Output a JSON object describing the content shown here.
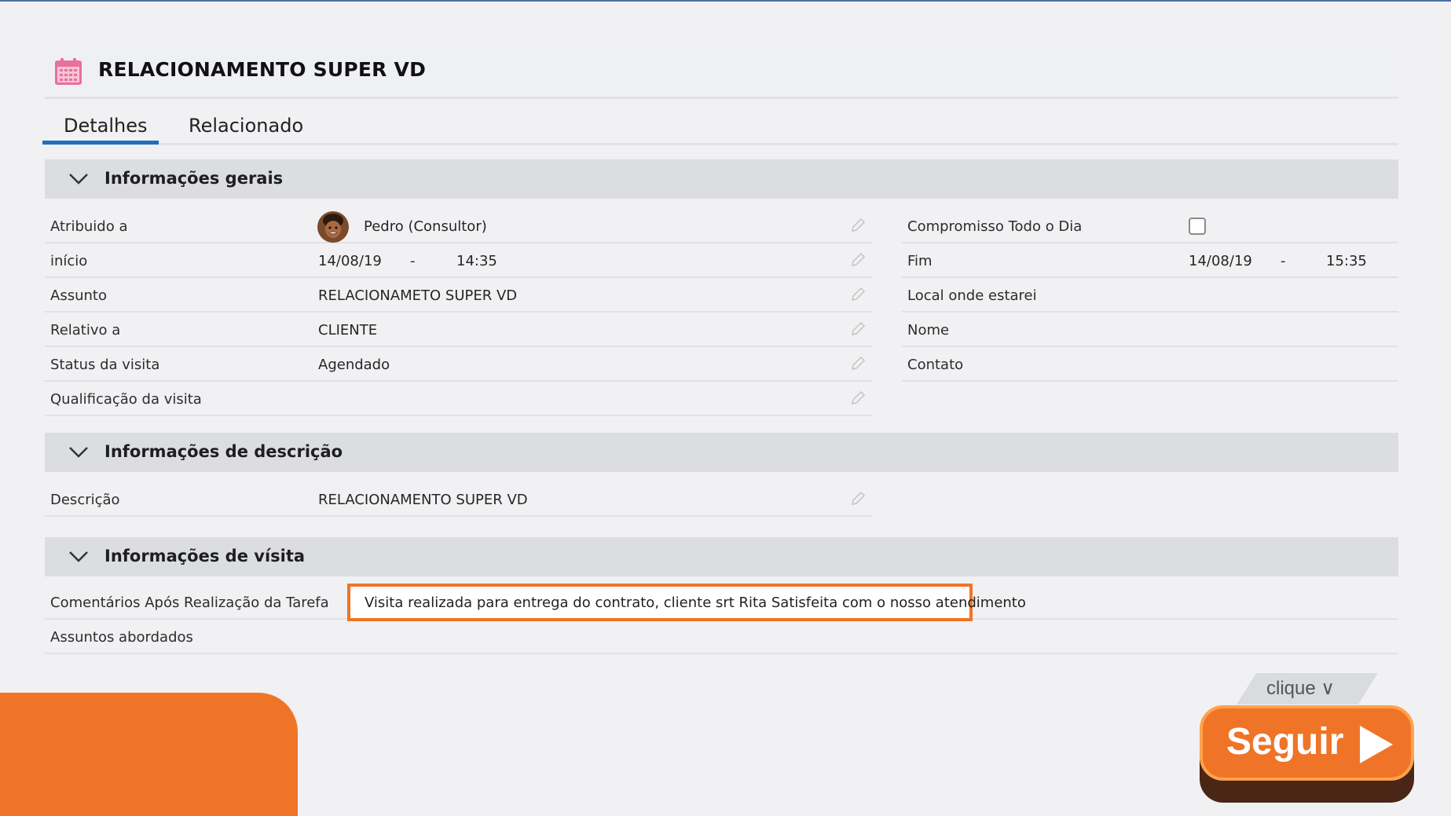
{
  "header": {
    "title": "RELACIONAMENTO SUPER VD",
    "icon": "calendar-icon",
    "icon_color": "#e8709a"
  },
  "tabs": [
    {
      "label": "Detalhes",
      "active": true
    },
    {
      "label": "Relacionado",
      "active": false
    }
  ],
  "sections": {
    "general": {
      "title": "Informações gerais",
      "left_rows": [
        {
          "label": "Atribuido a",
          "value": "Pedro (Consultor)"
        },
        {
          "label": "início",
          "date": "14/08/19",
          "sep": "-",
          "time": "14:35"
        },
        {
          "label": "Assunto",
          "value": "RELACIONAMETO SUPER VD"
        },
        {
          "label": "Relativo a",
          "value": "CLIENTE"
        },
        {
          "label": "Status da visita",
          "value": "Agendado"
        },
        {
          "label": "Qualificação da visita",
          "value": ""
        }
      ],
      "right_rows": [
        {
          "label": "Compromisso Todo o Dia",
          "checked": false
        },
        {
          "label": "Fim",
          "date": "14/08/19",
          "sep": "-",
          "time": "15:35"
        },
        {
          "label": "Local onde estarei"
        },
        {
          "label": "Nome"
        },
        {
          "label": "Contato"
        }
      ]
    },
    "description": {
      "title": "Informações de descrição",
      "rows": [
        {
          "label": "Descrição",
          "value": "RELACIONAMENTO SUPER VD"
        }
      ]
    },
    "visit": {
      "title": "Informações de vísita",
      "rows": [
        {
          "label": "Comentários Após Realização da Tarefa",
          "value": "Visita realizada para entrega do contrato, cliente srt Rita Satisfeita com o nosso atendimento"
        },
        {
          "label": "Assuntos abordados"
        }
      ]
    }
  },
  "overlay": {
    "hint": "clique ∨",
    "button_label": "Seguir",
    "accent_color": "#f07427"
  }
}
